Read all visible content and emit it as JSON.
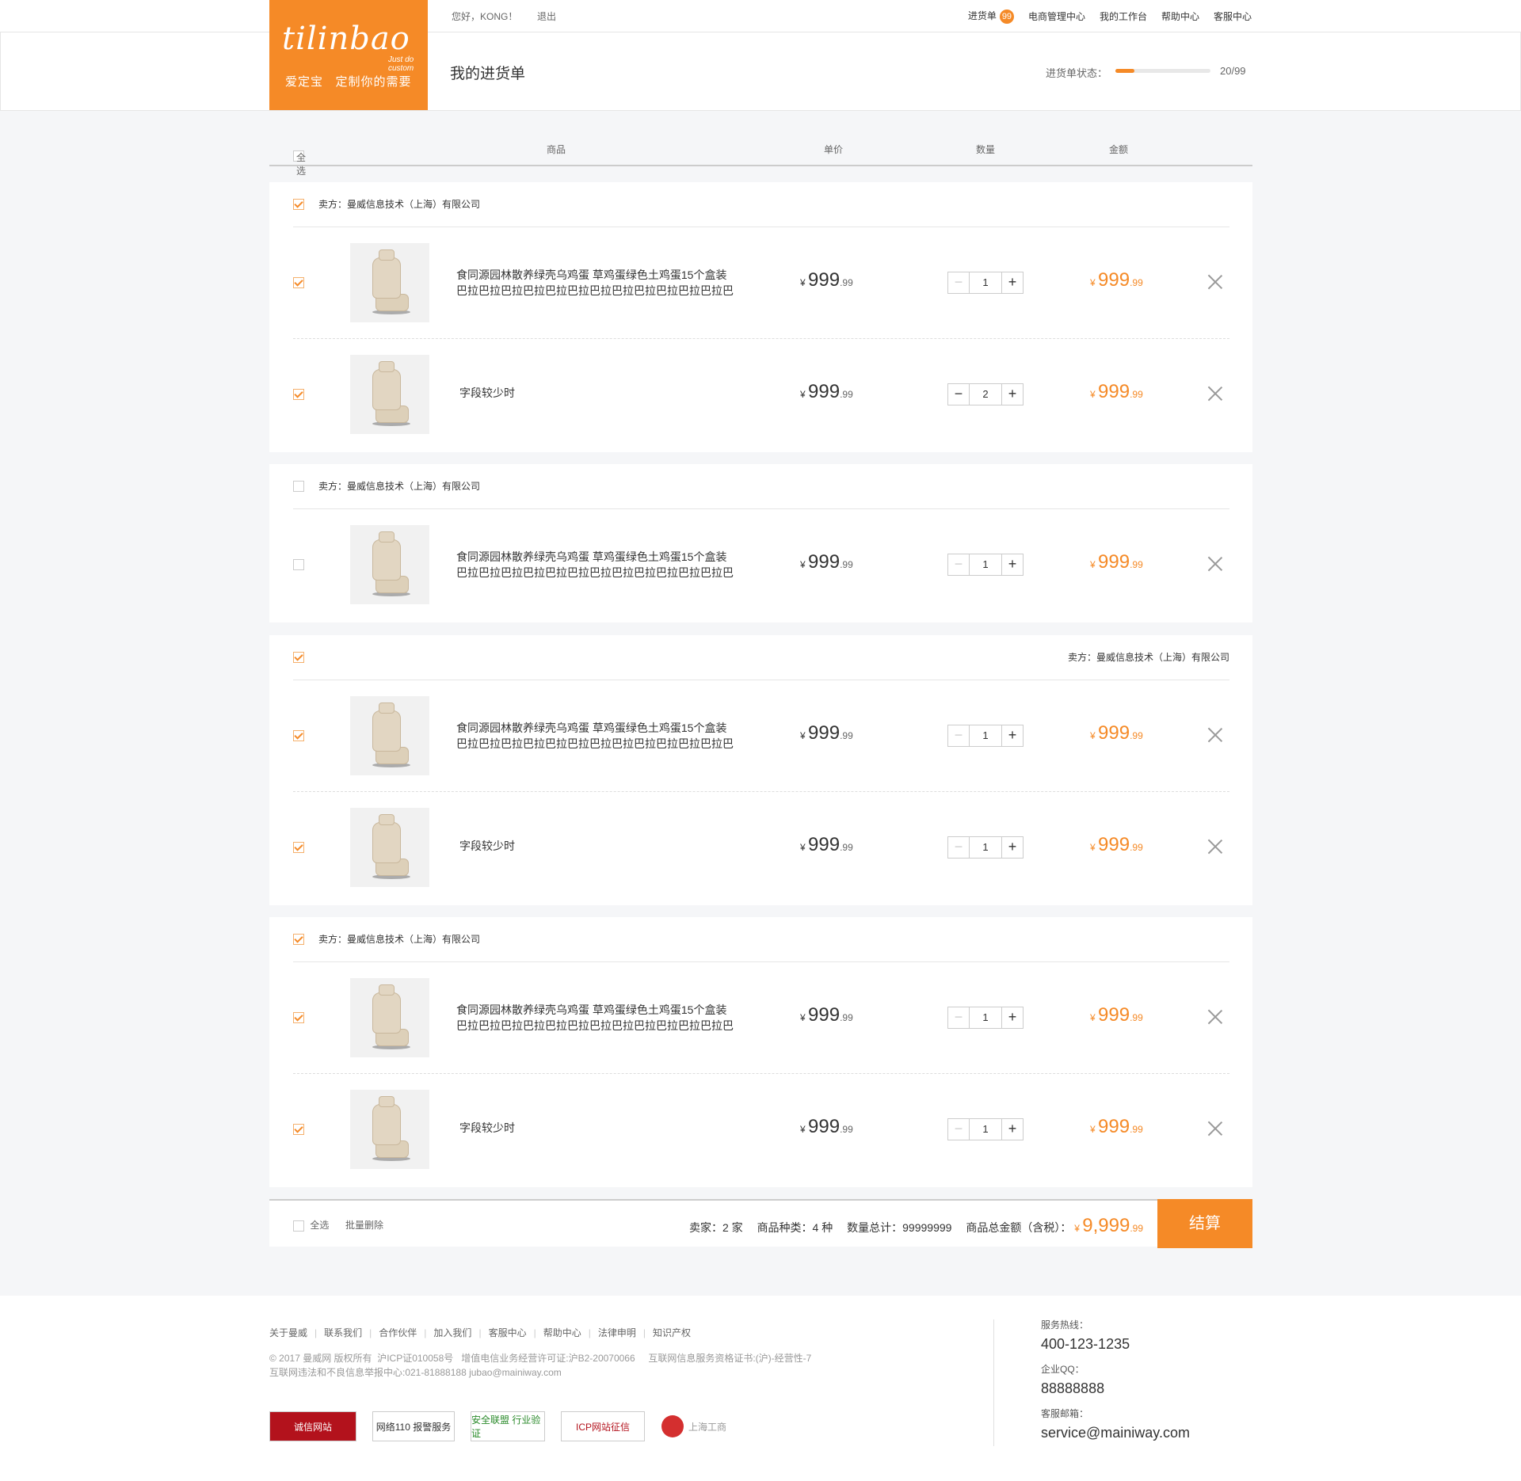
{
  "brand": {
    "name": "tilinbao",
    "slogan_en": "Just do custom",
    "slogan_cn": "爱定宝   定制你的需要"
  },
  "topbar": {
    "greeting": "您好，KONG！",
    "logout": "退出",
    "nav": {
      "cart": "进货单",
      "cart_badge": "99",
      "ecommerce": "电商管理中心",
      "workbench": "我的工作台",
      "help": "帮助中心",
      "service": "客服中心"
    }
  },
  "header": {
    "title": "我的进货单",
    "status_label": "进货单状态：",
    "status_value": "20/99",
    "status_progress": 0.2
  },
  "table_header": {
    "select_all": "全选",
    "product": "商品",
    "unit_price": "单价",
    "quantity": "数量",
    "amount": "金额"
  },
  "groups": [
    {
      "seller": "卖方：曼威信息技术（上海）有限公司",
      "checked": true,
      "items": [
        {
          "name1": "食同源园林散养绿壳乌鸡蛋 草鸡蛋绿色土鸡蛋15个盒装",
          "name2": "巴拉巴拉巴拉巴拉巴拉巴拉巴拉巴拉巴拉巴拉巴拉巴拉巴拉...",
          "price_int": "999",
          "price_dec": ".99",
          "qty": "1",
          "amount_int": "999",
          "amount_dec": ".99",
          "checked": true
        },
        {
          "name1": "字段较少时",
          "name2": "",
          "price_int": "999",
          "price_dec": ".99",
          "qty": "2",
          "amount_int": "999",
          "amount_dec": ".99",
          "checked": true
        }
      ]
    },
    {
      "seller": "卖方：曼威信息技术（上海）有限公司",
      "checked": false,
      "items": [
        {
          "name1": "食同源园林散养绿壳乌鸡蛋 草鸡蛋绿色土鸡蛋15个盒装",
          "name2": "巴拉巴拉巴拉巴拉巴拉巴拉巴拉巴拉巴拉巴拉巴拉巴拉巴拉...",
          "price_int": "999",
          "price_dec": ".99",
          "qty": "1",
          "amount_int": "999",
          "amount_dec": ".99",
          "checked": false
        }
      ]
    },
    {
      "seller": "卖方：曼威信息技术（上海）有限公司",
      "checked": true,
      "items": [
        {
          "name1": "食同源园林散养绿壳乌鸡蛋 草鸡蛋绿色土鸡蛋15个盒装",
          "name2": "巴拉巴拉巴拉巴拉巴拉巴拉巴拉巴拉巴拉巴拉巴拉巴拉巴拉...",
          "price_int": "999",
          "price_dec": ".99",
          "qty": "1",
          "amount_int": "999",
          "amount_dec": ".99",
          "checked": true
        },
        {
          "name1": "字段较少时",
          "name2": "",
          "price_int": "999",
          "price_dec": ".99",
          "qty": "1",
          "amount_int": "999",
          "amount_dec": ".99",
          "checked": true
        }
      ]
    },
    {
      "seller": "卖方：曼威信息技术（上海）有限公司",
      "checked": true,
      "items": [
        {
          "name1": "食同源园林散养绿壳乌鸡蛋 草鸡蛋绿色土鸡蛋15个盒装",
          "name2": "巴拉巴拉巴拉巴拉巴拉巴拉巴拉巴拉巴拉巴拉巴拉巴拉巴拉...",
          "price_int": "999",
          "price_dec": ".99",
          "qty": "1",
          "amount_int": "999",
          "amount_dec": ".99",
          "checked": true
        },
        {
          "name1": "字段较少时",
          "name2": "",
          "price_int": "999",
          "price_dec": ".99",
          "qty": "1",
          "amount_int": "999",
          "amount_dec": ".99",
          "checked": true
        }
      ]
    }
  ],
  "currency": "¥",
  "bottom": {
    "select_all": "全选",
    "batch_delete": "批量删除",
    "sellers": "卖家：2 家",
    "kinds": "商品种类：4 种",
    "qty_total": "数量总计：99999999",
    "total_label": "商品总金额（含税）：",
    "total_int": "9,999",
    "total_dec": ".99",
    "checkout": "结算"
  },
  "footer": {
    "links": [
      "关于曼威",
      "联系我们",
      "合作伙伴",
      "加入我们",
      "客服中心",
      "帮助中心",
      "法律申明",
      "知识产权"
    ],
    "copy1": "© 2017 曼威网 版权所有  沪ICP证010058号   增值电信业务经营许可证:沪B2-20070066     互联网信息服务资格证书:(沪)-经营性-7",
    "copy2": "互联网违法和不良信息举报中心:021-81888188 jubao@mainiway.com",
    "badges": [
      "诚信网站",
      "网络110 报警服务",
      "安全联盟 行业验证",
      "ICP网站征信",
      "上海工商"
    ],
    "hotline_label": "服务热线：",
    "hotline": "400-123-1235",
    "qq_label": "企业QQ：",
    "qq": "88888888",
    "email_label": "客服邮箱：",
    "email": "service@mainiway.com"
  }
}
